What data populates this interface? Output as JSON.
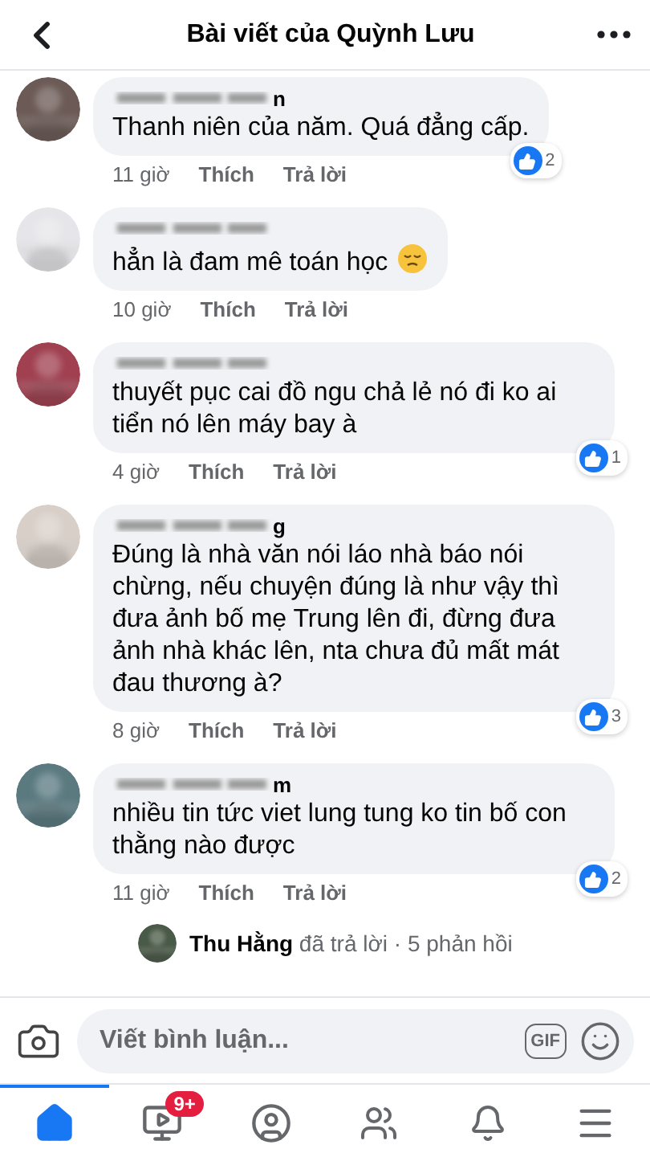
{
  "header": {
    "title": "Bài viết của Quỳnh Lưu"
  },
  "comments": [
    {
      "name_tail": "n",
      "text": "Thanh niên của năm. Quá đẳng cấp.",
      "time": "11 giờ",
      "like": "Thích",
      "reply": "Trả lời",
      "reactions": "2"
    },
    {
      "text": "hẳn là đam mê toán học",
      "emoji": true,
      "time": "10 giờ",
      "like": "Thích",
      "reply": "Trả lời"
    },
    {
      "text": "thuyết pục cai đồ ngu chả lẻ nó đi ko ai tiển nó lên máy bay à",
      "time": "4 giờ",
      "like": "Thích",
      "reply": "Trả lời",
      "reactions": "1"
    },
    {
      "name_tail": "g",
      "text": "Đúng là nhà văn nói láo nhà báo nói chừng, nếu chuyện đúng là như vậy thì đưa ảnh bố mẹ Trung lên đi, đừng đưa ảnh nhà khác lên, nta chưa đủ mất mát đau thương à?",
      "time": "8 giờ",
      "like": "Thích",
      "reply": "Trả lời",
      "reactions": "3"
    },
    {
      "name_tail": "m",
      "text": "nhiều tin tức viet lung tung ko tin bố con thằng nào được",
      "time": "11 giờ",
      "like": "Thích",
      "reply": "Trả lời",
      "reactions": "2",
      "reply_summary": {
        "name": "Thu Hằng",
        "action": "đã trả lời",
        "count": "· 5 phản hồi"
      }
    }
  ],
  "composer": {
    "placeholder": "Viết bình luận...",
    "gif_label": "GIF"
  },
  "tabs": [
    {
      "kind": "home",
      "selected": true
    },
    {
      "kind": "video",
      "selected": false,
      "badge": "9+"
    },
    {
      "kind": "profile",
      "selected": false
    },
    {
      "kind": "groups",
      "selected": false
    },
    {
      "kind": "bell",
      "selected": false
    },
    {
      "kind": "menu",
      "selected": false
    }
  ]
}
